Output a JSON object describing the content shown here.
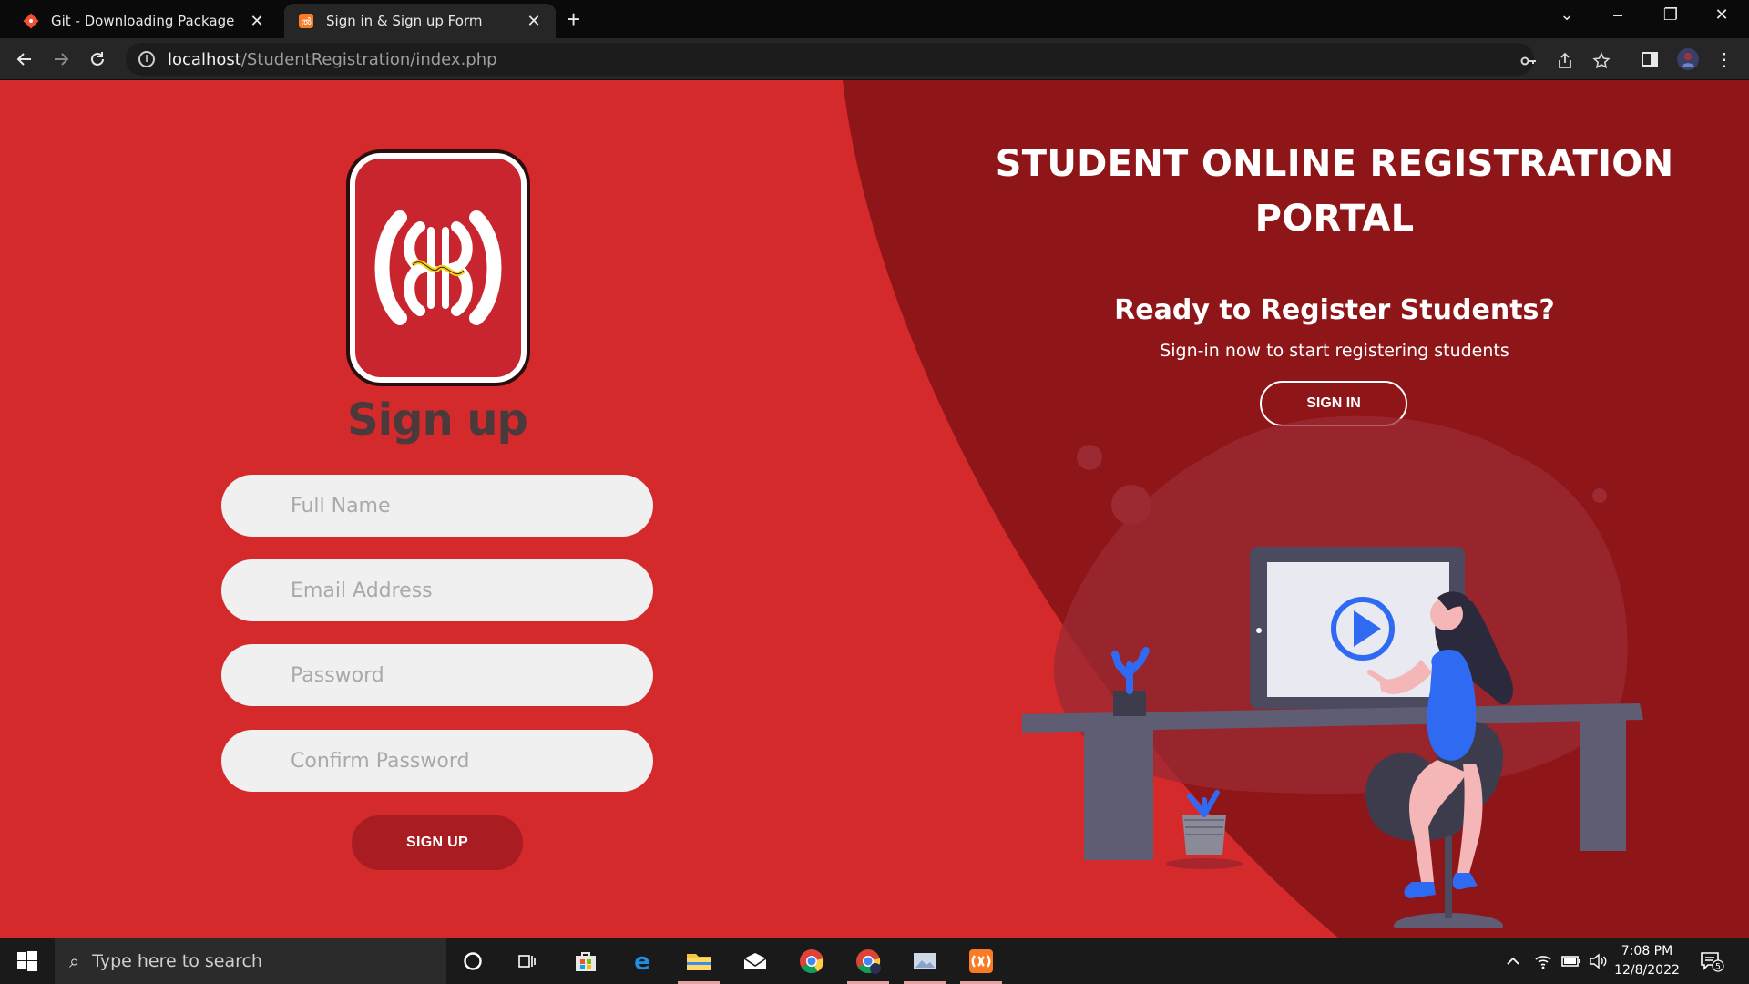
{
  "browser": {
    "tabs": [
      {
        "title": "Git - Downloading Package",
        "icon": "git-icon"
      },
      {
        "title": "Sign in & Sign up Form",
        "icon": "xampp-icon"
      }
    ],
    "new_tab": "+",
    "url_host": "localhost",
    "url_path": "/StudentRegistration/index.php"
  },
  "signup": {
    "title": "Sign up",
    "fields": [
      {
        "placeholder": "Full Name"
      },
      {
        "placeholder": "Email Address"
      },
      {
        "placeholder": "Password"
      },
      {
        "placeholder": "Confirm Password"
      }
    ],
    "button": "SIGN UP"
  },
  "panel": {
    "title": "STUDENT ONLINE REGISTRATION PORTAL",
    "heading": "Ready to Register Students?",
    "subtext": "Sign-in now to start registering students",
    "button": "SIGN IN"
  },
  "taskbar": {
    "search_placeholder": "Type here to search",
    "time": "7:08 PM",
    "date": "12/8/2022",
    "notifications": "5"
  },
  "colors": {
    "page_red": "#d42a2c",
    "panel_dark_red": "#8e1518",
    "signup_button": "#a81c22",
    "field_bg": "#f0f0f0"
  }
}
